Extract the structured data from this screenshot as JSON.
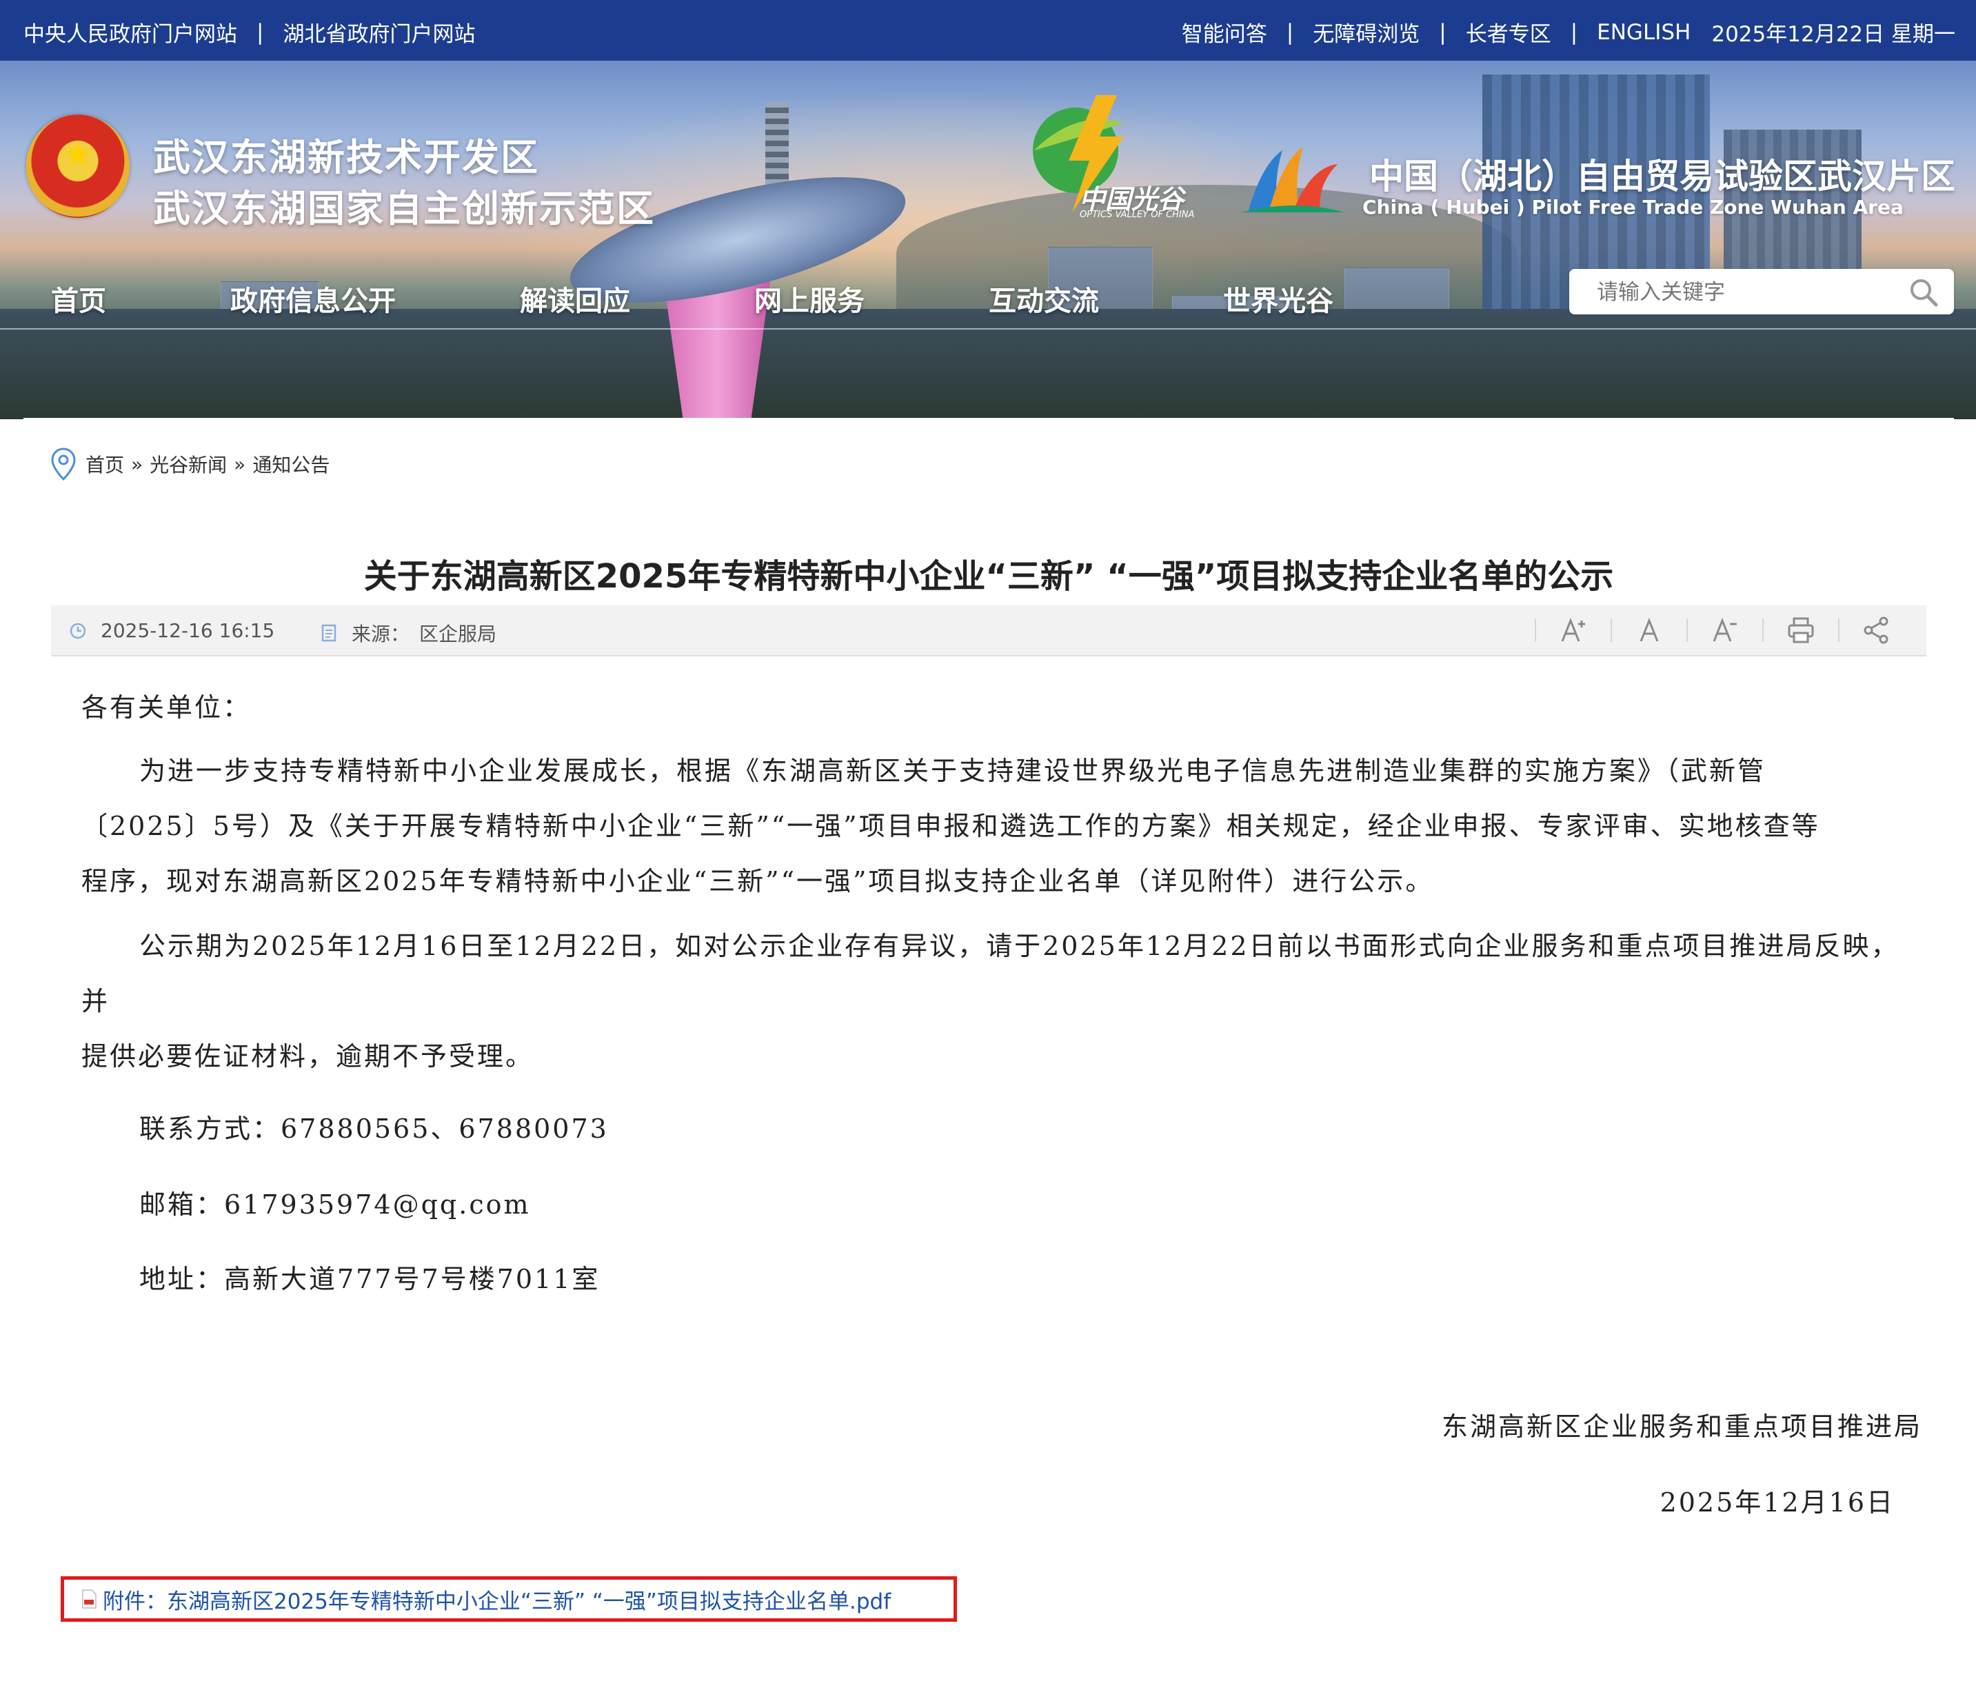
{
  "topbar": {
    "links_left": [
      "中央人民政府门户网站",
      "湖北省政府门户网站"
    ],
    "links_right": [
      "智能问答",
      "无障碍浏览",
      "长者专区",
      "ENGLISH"
    ],
    "separator": "|",
    "date": "2025年12月22日 星期一"
  },
  "banner": {
    "title_line1": "武汉东湖新技术开发区",
    "title_line2": "武汉东湖国家自主创新示范区",
    "ov_logo_text": "中国光谷",
    "ov_logo_sub": "OPTICS VALLEY OF CHINA",
    "ftz_title": "中国（湖北）自由贸易试验区武汉片区",
    "ftz_subtitle": "China ( Hubei ) Pilot Free Trade Zone Wuhan Area"
  },
  "nav": {
    "items": [
      "首页",
      "政府信息公开",
      "解读回应",
      "网上服务",
      "互动交流",
      "世界光谷"
    ]
  },
  "search": {
    "placeholder": "请输入关键字"
  },
  "breadcrumb": {
    "items": [
      "首页",
      "光谷新闻",
      "通知公告"
    ],
    "separator": "»"
  },
  "article": {
    "title": "关于东湖高新区2025年专精特新中小企业“三新” “一强”项目拟支持企业名单的公示",
    "date": "2025-12-16 16:15",
    "source_label": "来源：",
    "source": "区企服局",
    "salutation": "各有关单位：",
    "para1_line1": "为进一步支持专精特新中小企业发展成长，根据《东湖高新区关于支持建设世界级光电子信息先进制造业集群的实施方案》（武新管",
    "para1_line2": "〔2025〕5号）及《关于开展专精特新中小企业“三新”“一强”项目申报和遴选工作的方案》相关规定，经企业申报、专家评审、实地核查等",
    "para1_line3": "程序，现对东湖高新区2025年专精特新中小企业“三新”“一强”项目拟支持企业名单（详见附件）进行公示。",
    "para2_line1": "公示期为2025年12月16日至12月22日，如对公示企业存有异议，请于2025年12月22日前以书面形式向企业服务和重点项目推进局反映，并",
    "para2_line2": "提供必要佐证材料，逾期不予受理。",
    "contact_phone": "联系方式：67880565、67880073",
    "contact_email": "邮箱：617935974@qq.com",
    "contact_address": "地址：高新大道777号7号楼7011室",
    "signature_org": "东湖高新区企业服务和重点项目推进局",
    "signature_date": "2025年12月16日",
    "attachment": "附件：东湖高新区2025年专精特新中小企业“三新” “一强”项目拟支持企业名单.pdf"
  },
  "toolbar_icons": [
    "font-increase-icon",
    "font-reset-icon",
    "font-decrease-icon",
    "print-icon",
    "share-icon"
  ],
  "colors": {
    "topbar": "#1c3d8f",
    "link": "#1f53a6",
    "highlight_border": "#e01b1b"
  }
}
